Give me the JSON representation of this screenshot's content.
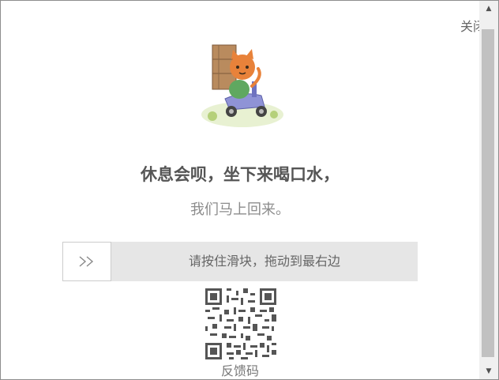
{
  "dialog": {
    "close_label": "关闭",
    "title": "休息会呗，坐下来喝口水，",
    "subtitle": "我们马上回来。",
    "slider": {
      "hint": "请按住滑块，拖动到最右边"
    },
    "feedback_label": "反馈码"
  },
  "colors": {
    "slider_track": "#e6e6e6",
    "title": "#555555",
    "subtitle": "#8c8c8c",
    "scrollbar_thumb": "#c1c1c1"
  },
  "icons": {
    "slider_handle": "double-chevron-right-icon",
    "scroll_up": "triangle-up-icon",
    "scroll_down": "triangle-down-icon"
  }
}
